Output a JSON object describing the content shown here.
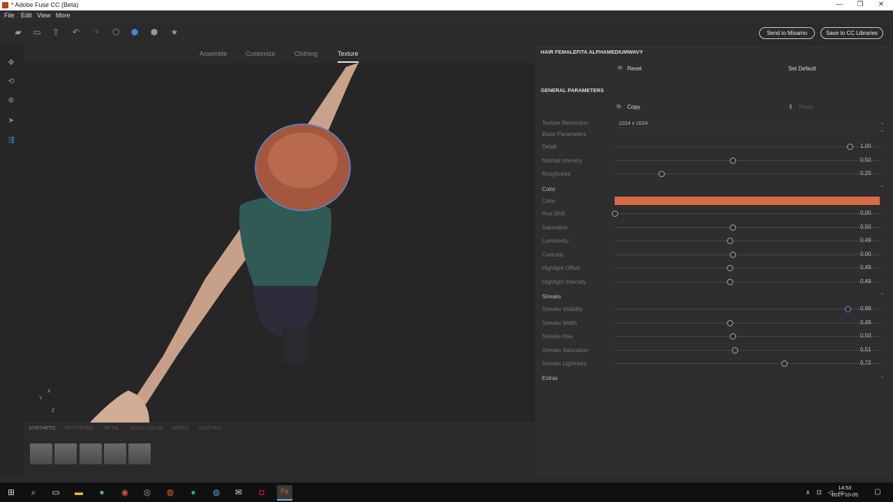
{
  "window": {
    "title": "* Adobe Fuse CC (Beta)",
    "minimize": "—",
    "restore": "❐",
    "close": "✕"
  },
  "menu": [
    "File",
    "Edit",
    "View",
    "More"
  ],
  "toolbar": {
    "send_label": "Send to Mixamo",
    "save_label": "Save to CC Libraries"
  },
  "tabs": [
    "Assemble",
    "Customize",
    "Clothing",
    "Texture"
  ],
  "active_tab": "Texture",
  "axis_gizmo": {
    "x": "X",
    "y": "Y",
    "z": "Z"
  },
  "materials": [
    "SYNTHETIC",
    "PATTERNED",
    "METAL",
    "SOLID COLOR",
    "FABRIC",
    "LEATHER"
  ],
  "panel": {
    "item_title": "HAIR FEMALEFITA ALPHAMEDIUMWAVY",
    "reset_label": "Reset",
    "set_default_label": "Set Default",
    "general_title": "GENERAL PARAMETERS",
    "copy_label": "Copy",
    "paste_label": "Paste",
    "texture_res_label": "Texture Resolution",
    "texture_res_value": "1024 x 1024",
    "basic_section": "Basic Parameters",
    "basic": [
      {
        "label": "Detail",
        "value": "1,00",
        "level": 1.0
      },
      {
        "label": "Normal Intensity",
        "value": "0,50",
        "level": 0.5
      },
      {
        "label": "Roughness",
        "value": "0,20",
        "level": 0.2
      }
    ],
    "color_section": "Color",
    "color_label": "Color",
    "color_hex": "#d96a48",
    "color_params": [
      {
        "label": "Hue Shift",
        "value": "0,00",
        "level": 0.0
      },
      {
        "label": "Saturation",
        "value": "0,50",
        "level": 0.5
      },
      {
        "label": "Luminosity",
        "value": "0,49",
        "level": 0.49
      },
      {
        "label": "Contrast",
        "value": "0,00",
        "level": 0.5
      },
      {
        "label": "Highlight Offset",
        "value": "0,49",
        "level": 0.49
      },
      {
        "label": "Highlight Intensity",
        "value": "0,49",
        "level": 0.49
      }
    ],
    "streaks_section": "Streaks",
    "streaks": [
      {
        "label": "Streaks Visibility",
        "value": "0,99",
        "level": 0.99
      },
      {
        "label": "Streaks Width",
        "value": "0,49",
        "level": 0.49
      },
      {
        "label": "Streaks Hue",
        "value": "0,50",
        "level": 0.5
      },
      {
        "label": "Streaks Saturation",
        "value": "0,51",
        "level": 0.51
      },
      {
        "label": "Streaks Lightness",
        "value": "0,72",
        "level": 0.72
      }
    ],
    "extras_section": "Extras"
  },
  "taskbar": {
    "time": "14:53",
    "date": "2017-10-05"
  }
}
